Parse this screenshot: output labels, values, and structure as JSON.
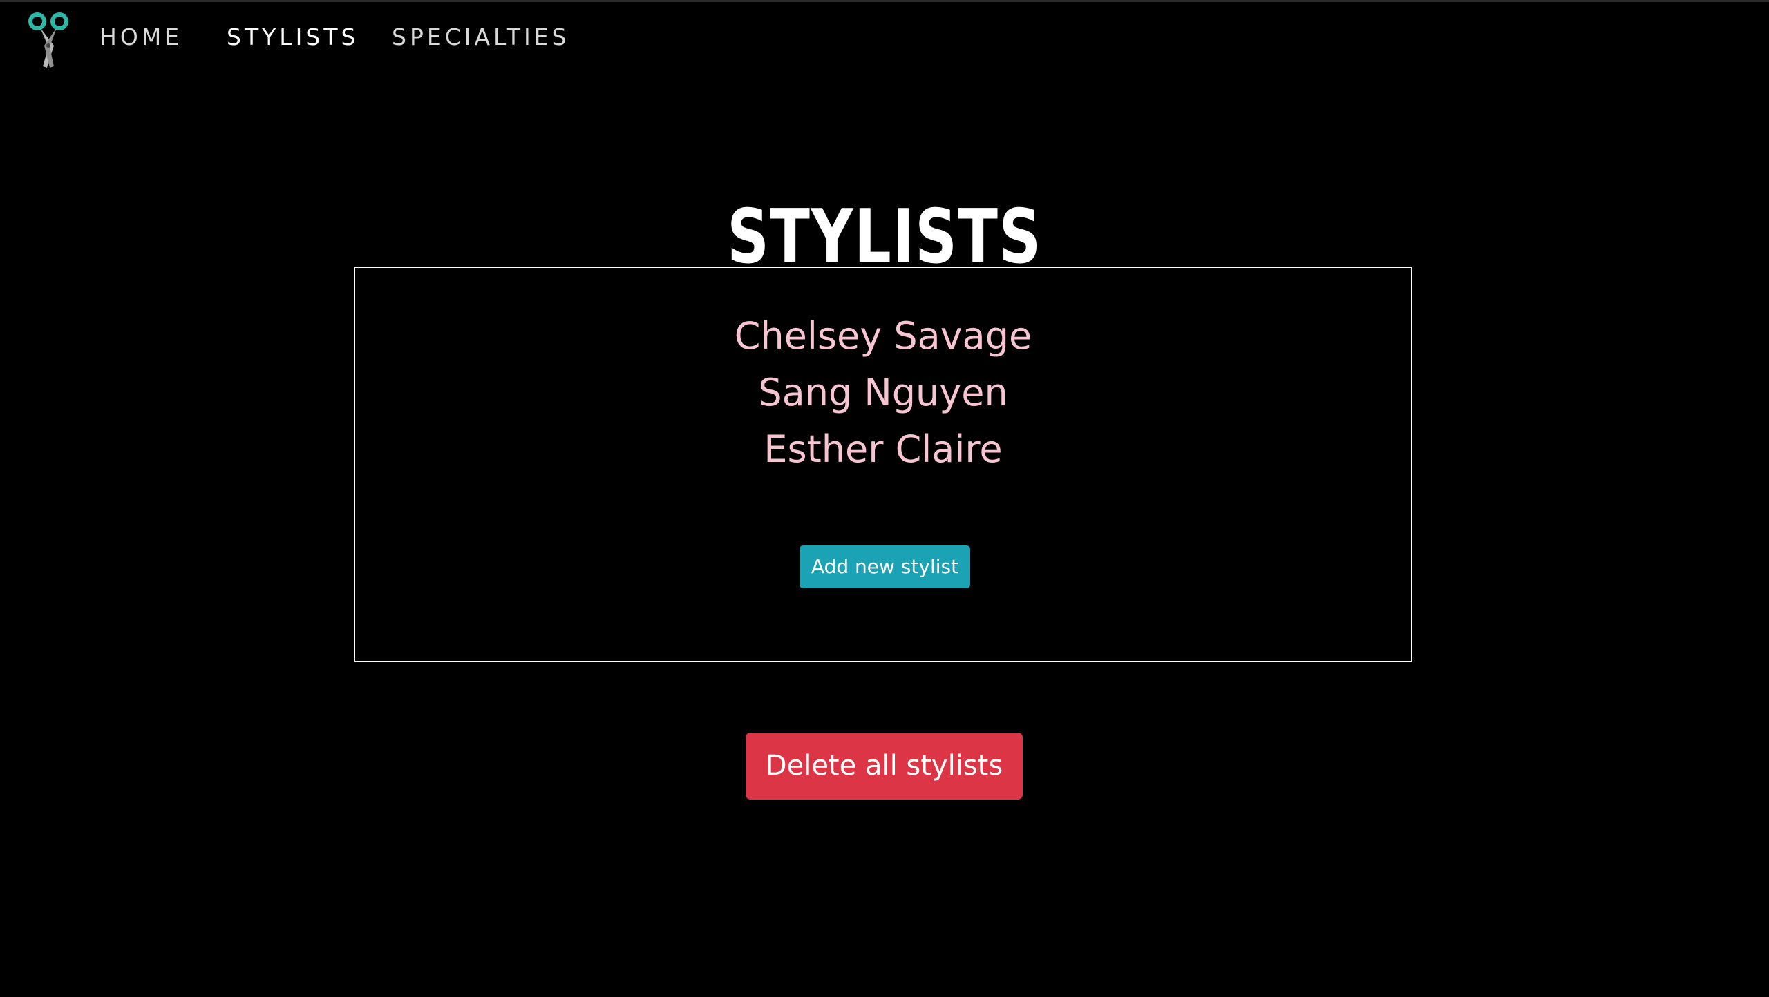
{
  "nav": {
    "logo_icon": "scissors-icon",
    "items": [
      {
        "label": "HOME"
      },
      {
        "label": "STYLISTS"
      },
      {
        "label": "SPECIALTIES"
      }
    ],
    "active": "STYLISTS"
  },
  "main": {
    "title": "STYLISTS",
    "stylists": [
      {
        "name": "Chelsey Savage"
      },
      {
        "name": "Sang Nguyen"
      },
      {
        "name": "Esther Claire"
      }
    ],
    "add_button_label": "Add new stylist",
    "delete_button_label": "Delete all stylists"
  },
  "colors": {
    "background": "#000000",
    "stylist_name": "#f7c4d1",
    "add_button": "#1ba2b5",
    "delete_button": "#dc3545",
    "logo_accent": "#2bb9a8"
  }
}
